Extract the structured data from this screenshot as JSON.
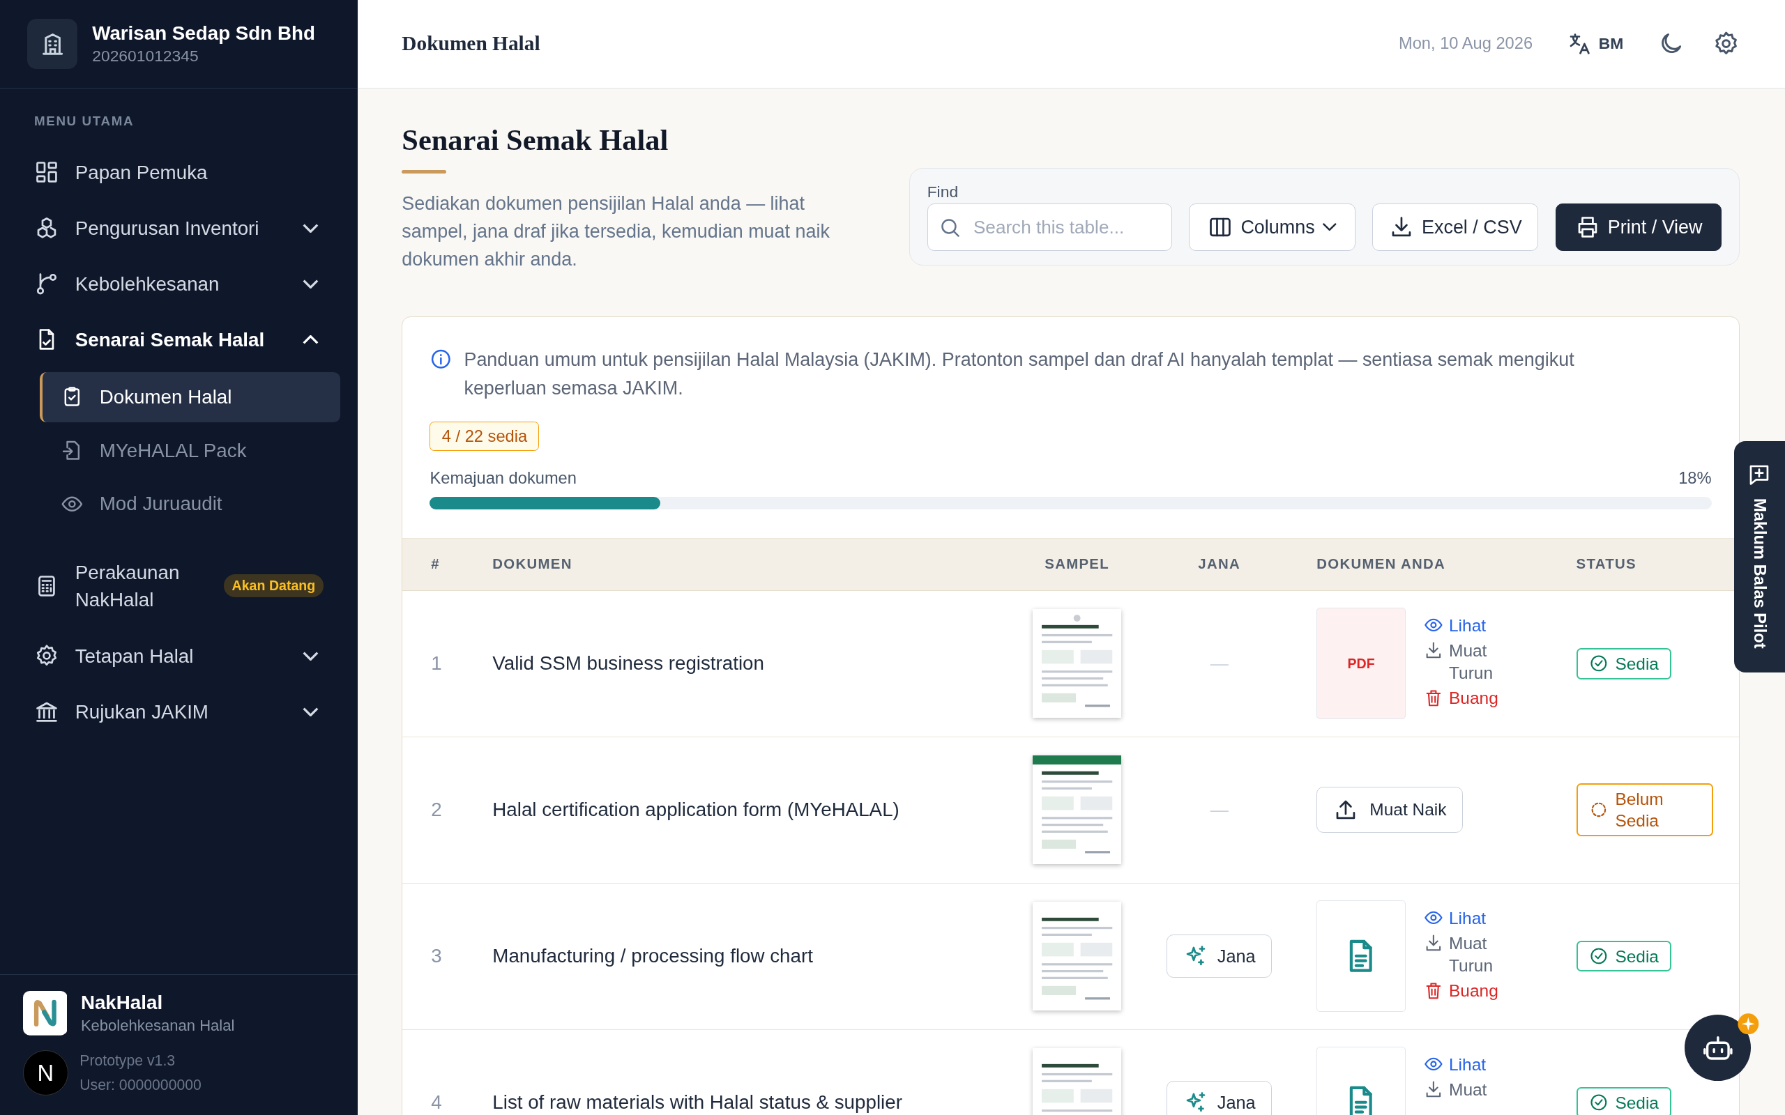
{
  "sidebar": {
    "company": {
      "name": "Warisan Sedap Sdn Bhd",
      "id": "202601012345"
    },
    "section_label": "MENU UTAMA",
    "items": [
      {
        "label": "Papan Pemuka"
      },
      {
        "label": "Pengurusan Inventori",
        "expanded": false
      },
      {
        "label": "Kebolehkesanan",
        "expanded": false
      },
      {
        "label": "Senarai Semak Halal",
        "expanded": true,
        "children": [
          {
            "label": "Dokumen Halal",
            "selected": true
          },
          {
            "label": "MYeHALAL Pack",
            "selected": false
          },
          {
            "label": "Mod Juruaudit",
            "selected": false
          }
        ]
      },
      {
        "label": "Perakaunan NakHalal",
        "badge": "Akan Datang"
      },
      {
        "label": "Tetapan Halal",
        "expanded": false
      },
      {
        "label": "Rujukan JAKIM",
        "expanded": false
      }
    ],
    "footer": {
      "app_name": "NakHalal",
      "tagline": "Kebolehkesanan Halal",
      "version": "Prototype v1.3",
      "user": "User: 0000000000"
    }
  },
  "dev_badge": {
    "label": "N"
  },
  "header": {
    "title": "Dokumen Halal",
    "date": "Mon, 10 Aug 2026",
    "language": "BM"
  },
  "page": {
    "title": "Senarai Semak Halal",
    "description": "Sediakan dokumen pensijilan Halal anda — lihat sampel, jana draf jika tersedia, kemudian muat naik dokumen akhir anda."
  },
  "toolbar": {
    "find_label": "Find",
    "search": {
      "placeholder": "Search this table..."
    },
    "buttons": [
      {
        "kind": "columns",
        "label": "Columns"
      },
      {
        "kind": "export",
        "label": "Excel / CSV"
      },
      {
        "kind": "print",
        "label": "Print / View"
      }
    ]
  },
  "notice": "Panduan umum untuk pensijilan Halal Malaysia (JAKIM). Pratonton sampel dan draf AI hanyalah templat — sentiasa semak mengikut keperluan semasa JAKIM.",
  "ready_badge": "4 / 22 sedia",
  "progress": {
    "label": "Kemajuan dokumen",
    "reading": "18%",
    "level": 0.18
  },
  "table": {
    "columns": [
      "#",
      "DOKUMEN",
      "SAMPEL",
      "JANA",
      "DOKUMEN ANDA",
      "STATUS"
    ],
    "rows": [
      {
        "number": "1",
        "document": "Valid SSM business registration",
        "sample": {
          "kind": "picture"
        },
        "jana": {
          "kind": "none",
          "label": "—"
        },
        "file": {
          "kind": "pdf",
          "label": "PDF"
        },
        "actions": [
          {
            "kind": "view",
            "label": "Lihat"
          },
          {
            "kind": "download",
            "label": "Muat Turun"
          },
          {
            "kind": "delete",
            "label": "Buang"
          }
        ],
        "status": {
          "kind": "ready",
          "label": "Sedia"
        }
      },
      {
        "number": "2",
        "document": "Halal certification application form (MYeHALAL)",
        "sample": {
          "kind": "picture"
        },
        "jana": {
          "kind": "none",
          "label": "—"
        },
        "file": {
          "kind": "upload",
          "label": "Muat Naik"
        },
        "status": {
          "kind": "pending",
          "label": "Belum Sedia"
        }
      },
      {
        "number": "3",
        "document": "Manufacturing / processing flow chart",
        "sample": {
          "kind": "picture"
        },
        "jana": {
          "kind": "button",
          "label": "Jana"
        },
        "file": {
          "kind": "doc"
        },
        "actions": [
          {
            "kind": "view",
            "label": "Lihat"
          },
          {
            "kind": "download",
            "label": "Muat Turun"
          },
          {
            "kind": "delete",
            "label": "Buang"
          }
        ],
        "status": {
          "kind": "ready",
          "label": "Sedia"
        }
      },
      {
        "number": "4",
        "document": "List of raw materials with Halal status & supplier",
        "sample": {
          "kind": "picture"
        },
        "jana": {
          "kind": "button",
          "label": "Jana"
        },
        "file": {
          "kind": "doc"
        },
        "actions": [
          {
            "kind": "view",
            "label": "Lihat"
          },
          {
            "kind": "download",
            "label": "Muat"
          }
        ],
        "status": {
          "kind": "ready",
          "label": "Sedia"
        }
      }
    ]
  },
  "feedback_tab": {
    "label": "Maklum Balas Pilot"
  }
}
